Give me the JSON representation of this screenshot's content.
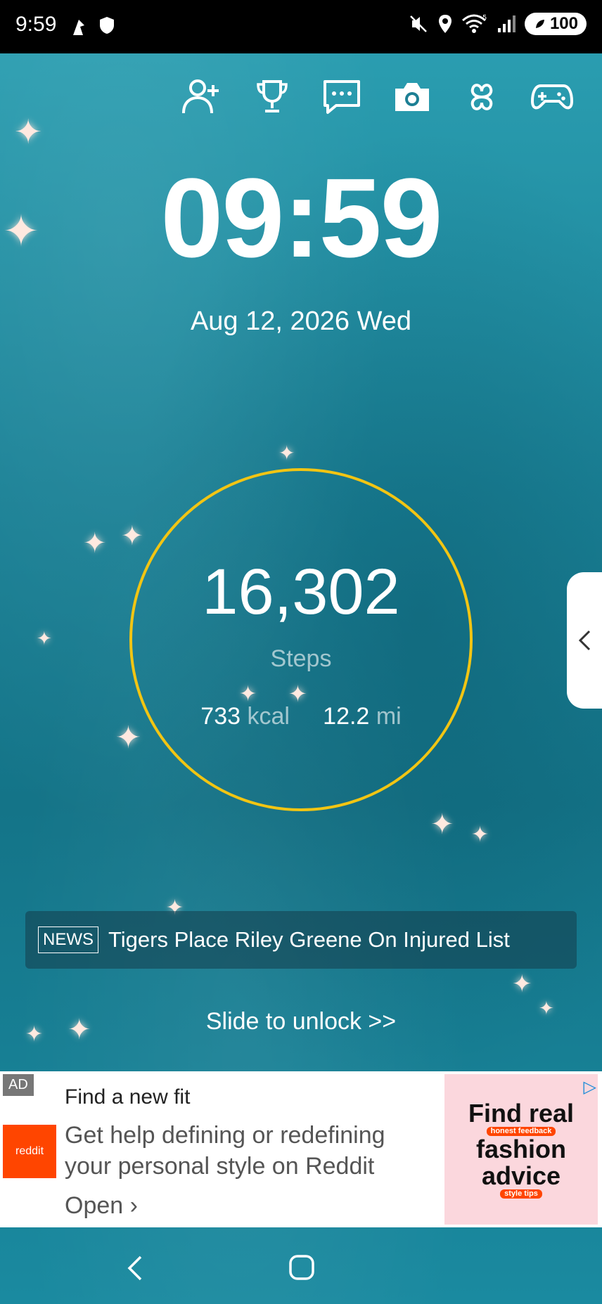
{
  "status_bar": {
    "time": "9:59",
    "battery": "100",
    "icons": [
      "upload-icon",
      "shield-icon",
      "mute-icon",
      "location-icon",
      "wifi-icon",
      "signal-icon"
    ]
  },
  "top_icons": [
    "add-friend-icon",
    "trophy-icon",
    "chat-icon",
    "camera-icon",
    "clover-icon",
    "gamepad-icon"
  ],
  "clock": {
    "time": "09:59",
    "date": "Aug 12, 2026 Wed"
  },
  "pedometer": {
    "steps": "16,302",
    "steps_label": "Steps",
    "kcal_value": "733",
    "kcal_unit": "kcal",
    "distance_value": "12.2",
    "distance_unit": "mi",
    "ring_color": "#f2c513"
  },
  "news": {
    "tag": "NEWS",
    "headline": "Tigers Place Riley Greene On Injured List"
  },
  "unlock": {
    "label": "Slide to unlock >>"
  },
  "ad": {
    "badge": "AD",
    "advertiser": "reddit",
    "title": "Find a new fit",
    "body": "Get help defining or redefining your personal style on Reddit",
    "cta": "Open",
    "image_line1": "Find real",
    "image_line2": "fashion",
    "image_line3": "advice",
    "image_pill1": "honest feedback",
    "image_pill2": "style tips",
    "brand_color": "#ff4500"
  }
}
